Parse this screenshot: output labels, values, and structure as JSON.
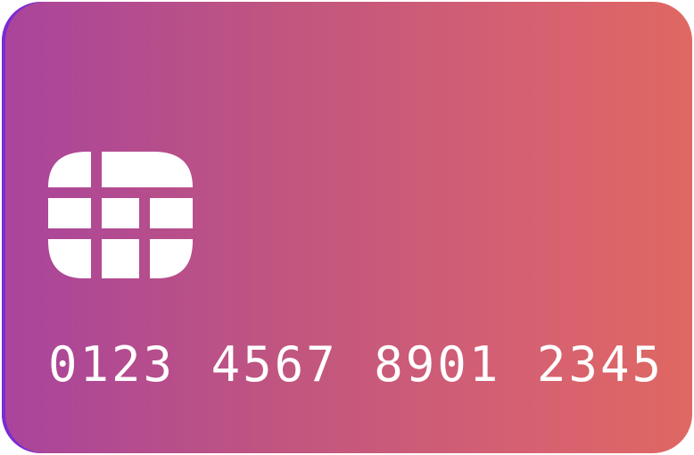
{
  "card": {
    "number_groups": [
      "0123",
      "4567",
      "8901",
      "2345"
    ],
    "colors": {
      "gradient_start": "#a9449c",
      "gradient_end": "#df6862",
      "edge_accent": "#7a2bd4",
      "text": "#ffffff"
    },
    "chip_icon": "emv-chip-icon"
  }
}
